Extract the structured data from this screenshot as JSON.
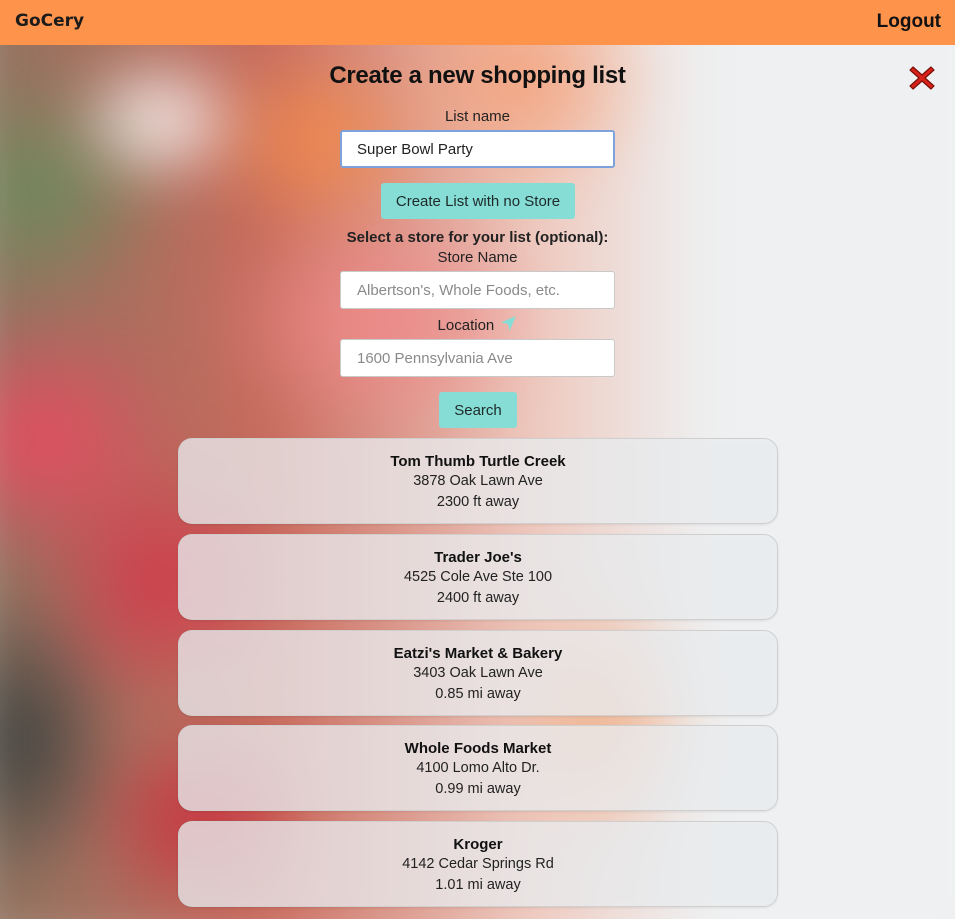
{
  "header": {
    "brand": "GoCery",
    "logout_label": "Logout"
  },
  "form": {
    "title": "Create a new shopping list",
    "list_name_label": "List name",
    "list_name_value": "Super Bowl Party",
    "create_no_store_label": "Create List with no Store",
    "select_store_prompt": "Select a store for your list (optional):",
    "store_name_label": "Store Name",
    "store_name_placeholder": "Albertson's, Whole Foods, etc.",
    "location_label": "Location",
    "location_placeholder": "1600 Pennsylvania Ave",
    "search_label": "Search"
  },
  "stores": [
    {
      "name": "Tom Thumb Turtle Creek",
      "address": "3878 Oak Lawn Ave",
      "distance": "2300 ft away"
    },
    {
      "name": "Trader Joe's",
      "address": "4525 Cole Ave Ste 100",
      "distance": "2400 ft away"
    },
    {
      "name": "Eatzi's Market & Bakery",
      "address": "3403 Oak Lawn Ave",
      "distance": "0.85 mi away"
    },
    {
      "name": "Whole Foods Market",
      "address": "4100 Lomo Alto Dr.",
      "distance": "0.99 mi away"
    },
    {
      "name": "Kroger",
      "address": "4142 Cedar Springs Rd",
      "distance": "1.01 mi away"
    }
  ],
  "icons": {
    "close": "close-icon",
    "location": "location-arrow-icon"
  },
  "colors": {
    "header_bg": "#fe934c",
    "button_bg": "#86ddd5",
    "close_red": "#d8221a"
  }
}
